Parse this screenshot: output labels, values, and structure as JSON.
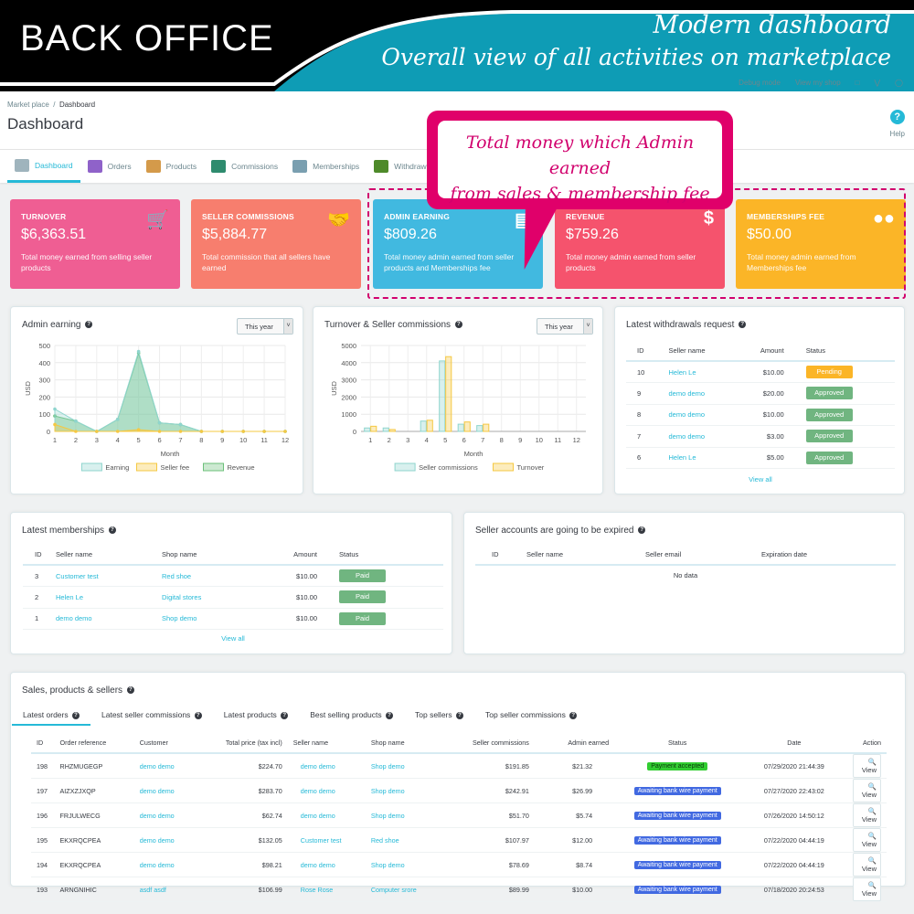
{
  "banner": {
    "left_title": "BACK OFFICE",
    "right_title_1": "Modern dashboard",
    "right_title_2": "Overall view of all activities on marketplace"
  },
  "topbar": {
    "debug": "Debug mode",
    "view_shop": "View my shop"
  },
  "breadcrumb": {
    "parent": "Market place",
    "sep": "/",
    "current": "Dashboard"
  },
  "page_title": "Dashboard",
  "help_label": "Help",
  "tabs": [
    {
      "label": "Dashboard",
      "icon": "dashboard-icon",
      "active": true
    },
    {
      "label": "Orders",
      "icon": "cart-icon"
    },
    {
      "label": "Products",
      "icon": "box-icon"
    },
    {
      "label": "Commissions",
      "icon": "money-bag-icon"
    },
    {
      "label": "Memberships",
      "icon": "membership-icon"
    },
    {
      "label": "Withdrawals",
      "icon": "withdraw-icon"
    }
  ],
  "callout": {
    "line1": "Total money which Admin earned",
    "line2": "from sales & membership fee"
  },
  "cards": [
    {
      "label": "TURNOVER",
      "value": "$6,363.51",
      "desc": "Total money earned from selling seller products",
      "color": "#ef5e93",
      "icon": "cart-icon"
    },
    {
      "label": "SELLER COMMISSIONS",
      "value": "$5,884.77",
      "desc": "Total commission that all sellers have earned",
      "color": "#f77e6e",
      "icon": "handshake-icon"
    },
    {
      "label": "ADMIN EARNING",
      "value": "$809.26",
      "desc": "Total money admin earned from seller products and Memberships fee",
      "color": "#41b9e0",
      "icon": "credit-card-icon"
    },
    {
      "label": "REVENUE",
      "value": "$759.26",
      "desc": "Total money admin earned from seller products",
      "color": "#f5536d",
      "icon": "dollar-icon"
    },
    {
      "label": "MEMBERSHIPS FEE",
      "value": "$50.00",
      "desc": "Total money admin earned from Memberships fee",
      "color": "#fbb527",
      "icon": "users-icon"
    }
  ],
  "admin_chart_panel": {
    "title": "Admin earning",
    "period": "This year"
  },
  "turnover_chart_panel": {
    "title": "Turnover & Seller commissions",
    "period": "This year"
  },
  "chart_data": [
    {
      "type": "area",
      "title": "Admin earning",
      "xlabel": "Month",
      "ylabel": "USD",
      "x": [
        1,
        2,
        3,
        4,
        5,
        6,
        7,
        8,
        9,
        10,
        11,
        12
      ],
      "ylim": [
        0,
        500
      ],
      "yticks": [
        0,
        100,
        200,
        300,
        400,
        500
      ],
      "grid": true,
      "legend": "bottom",
      "series": [
        {
          "name": "Earning",
          "color": "#8fd5ce",
          "values": [
            130,
            60,
            0,
            70,
            465,
            50,
            40,
            0,
            0,
            0,
            0,
            0
          ]
        },
        {
          "name": "Seller fee",
          "color": "#f5c842",
          "values": [
            40,
            0,
            0,
            0,
            10,
            0,
            0,
            0,
            0,
            0,
            0,
            0
          ]
        },
        {
          "name": "Revenue",
          "color": "#6cc07a",
          "values": [
            90,
            60,
            0,
            70,
            455,
            50,
            40,
            0,
            0,
            0,
            0,
            0
          ]
        }
      ]
    },
    {
      "type": "bar",
      "title": "Turnover & Seller commissions",
      "xlabel": "Month",
      "ylabel": "USD",
      "categories": [
        "1",
        "2",
        "3",
        "4",
        "5",
        "6",
        "7",
        "8",
        "9",
        "10",
        "11",
        "12"
      ],
      "ylim": [
        0,
        5000
      ],
      "yticks": [
        0,
        1000,
        2000,
        3000,
        4000,
        5000
      ],
      "grid": true,
      "legend": "bottom",
      "series": [
        {
          "name": "Seller commissions",
          "color": "#8fd5ce",
          "values": [
            200,
            200,
            0,
            600,
            4100,
            420,
            340,
            0,
            0,
            0,
            0,
            0
          ]
        },
        {
          "name": "Turnover",
          "color": "#f5c842",
          "values": [
            300,
            110,
            0,
            650,
            4350,
            550,
            420,
            0,
            0,
            0,
            0,
            0
          ]
        }
      ]
    }
  ],
  "withdrawals": {
    "title": "Latest withdrawals request",
    "headers": [
      "ID",
      "Seller name",
      "Amount",
      "Status"
    ],
    "rows": [
      {
        "id": "10",
        "seller": "Helen Le",
        "amount": "$10.00",
        "status": "Pending",
        "color": "#fbb527"
      },
      {
        "id": "9",
        "seller": "demo demo",
        "amount": "$20.00",
        "status": "Approved",
        "color": "#70b580"
      },
      {
        "id": "8",
        "seller": "demo demo",
        "amount": "$10.00",
        "status": "Approved",
        "color": "#70b580"
      },
      {
        "id": "7",
        "seller": "demo demo",
        "amount": "$3.00",
        "status": "Approved",
        "color": "#70b580"
      },
      {
        "id": "6",
        "seller": "Helen Le",
        "amount": "$5.00",
        "status": "Approved",
        "color": "#70b580"
      }
    ],
    "view_all": "View all"
  },
  "memberships": {
    "title": "Latest memberships",
    "headers": [
      "ID",
      "Seller name",
      "Shop name",
      "Amount",
      "Status"
    ],
    "rows": [
      {
        "id": "3",
        "seller": "Customer test",
        "shop": "Red shoe",
        "amount": "$10.00",
        "status": "Paid"
      },
      {
        "id": "2",
        "seller": "Helen Le",
        "shop": "Digital stores",
        "amount": "$10.00",
        "status": "Paid"
      },
      {
        "id": "1",
        "seller": "demo demo",
        "shop": "Shop demo",
        "amount": "$10.00",
        "status": "Paid"
      }
    ],
    "view_all": "View all"
  },
  "expiring": {
    "title": "Seller accounts are going to be expired",
    "headers": [
      "ID",
      "Seller name",
      "Seller email",
      "Expiration date"
    ],
    "empty": "No data"
  },
  "sales": {
    "title": "Sales, products & sellers",
    "tabs": [
      "Latest orders",
      "Latest seller commissions",
      "Latest products",
      "Best selling products",
      "Top sellers",
      "Top seller commissions"
    ],
    "headers": [
      "ID",
      "Order reference",
      "Customer",
      "Total price (tax incl)",
      "Seller name",
      "Shop name",
      "Seller commissions",
      "Admin earned",
      "Status",
      "Date",
      "Action"
    ],
    "view_label": "View",
    "rows": [
      {
        "id": "198",
        "ref": "RHZMUGEGP",
        "customer": "demo demo",
        "total": "$224.70",
        "seller": "demo demo",
        "shop": "Shop demo",
        "commission": "$191.85",
        "admin": "$21.32",
        "status": "Payment accepted",
        "status_color": "#32cd32",
        "date": "07/29/2020 21:44:39"
      },
      {
        "id": "197",
        "ref": "AIZXZJXQP",
        "customer": "demo demo",
        "total": "$283.70",
        "seller": "demo demo",
        "shop": "Shop demo",
        "commission": "$242.91",
        "admin": "$26.99",
        "status": "Awaiting bank wire payment",
        "status_color": "#4169e1",
        "date": "07/27/2020 22:43:02"
      },
      {
        "id": "196",
        "ref": "FRJULWECG",
        "customer": "demo demo",
        "total": "$62.74",
        "seller": "demo demo",
        "shop": "Shop demo",
        "commission": "$51.70",
        "admin": "$5.74",
        "status": "Awaiting bank wire payment",
        "status_color": "#4169e1",
        "date": "07/26/2020 14:50:12"
      },
      {
        "id": "195",
        "ref": "EKXRQCPEA",
        "customer": "demo demo",
        "total": "$132.05",
        "seller": "Customer test",
        "shop": "Red shoe",
        "commission": "$107.97",
        "admin": "$12.00",
        "status": "Awaiting bank wire payment",
        "status_color": "#4169e1",
        "date": "07/22/2020 04:44:19"
      },
      {
        "id": "194",
        "ref": "EKXRQCPEA",
        "customer": "demo demo",
        "total": "$98.21",
        "seller": "demo demo",
        "shop": "Shop demo",
        "commission": "$78.69",
        "admin": "$8.74",
        "status": "Awaiting bank wire payment",
        "status_color": "#4169e1",
        "date": "07/22/2020 04:44:19"
      },
      {
        "id": "193",
        "ref": "ARNGNIHIC",
        "customer": "asdf asdf",
        "total": "$106.99",
        "seller": "Rose Rose",
        "shop": "Computer srore",
        "commission": "$89.99",
        "admin": "$10.00",
        "status": "Awaiting bank wire payment",
        "status_color": "#4169e1",
        "date": "07/18/2020 20:24:53"
      }
    ]
  }
}
